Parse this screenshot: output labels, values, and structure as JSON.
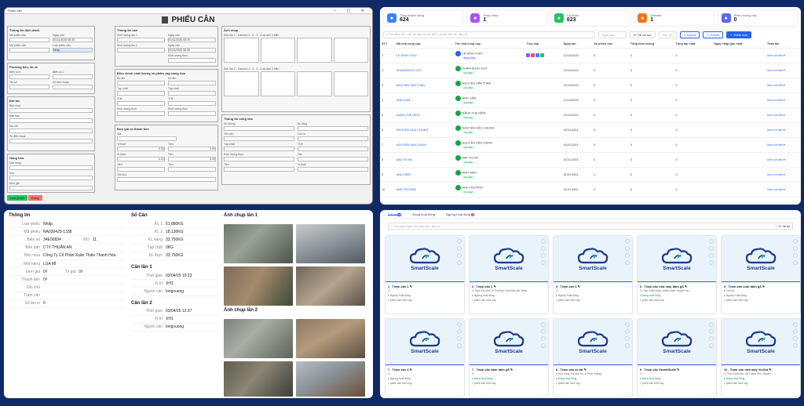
{
  "form": {
    "window_title": "Phiếu cân",
    "title": "PHIẾU CÂN",
    "sec_info": "Thông tin định danh",
    "sec_route": "Phương tiện, lái xe",
    "sec_partner": "Đối tác",
    "sec_goods": "Hàng hóa",
    "sec_scale": "Thông tin cân",
    "sec_quality": "Điều chỉnh chất lượng và phẩm cấp hàng hóa",
    "sec_price": "Đơn giá và thành tiền",
    "sec_img1": "Ảnh chụp",
    "img1_caption": "Ảnh lần 1 - Camera 1 - 2 - 3 - 4 và ảnh 2 biển",
    "img2_caption": "Ảnh lần 2 - Camera 1 - 2 - 3 - 4 và ảnh 2 biển",
    "sec_inout": "Thông tin cổng vào",
    "btn_save": "Lưu (F10)",
    "btn_close": "Đóng",
    "f_phieu": "Mã phiếu cân",
    "f_ngay": "Ngày cân",
    "f_loai": "Loại phiếu cân",
    "loai_val": "Nhập",
    "f_bien": "Biển số 1",
    "f_bien2": "Biển số 2",
    "f_taixe": "Tài xế",
    "f_sdt": "Số điện thoại",
    "f_ben": "Bên mua",
    "f_benban": "Bên bán",
    "f_diachi": "Địa chỉ",
    "f_hang": "Mặt hàng",
    "f_kho": "Kho",
    "f_dongia": "Đơn giá",
    "f_chuan": "Tỉ trọng chuẩn",
    "f_kl1": "Khối lượng lần 1",
    "f_kl2": "Khối lượng lần 2",
    "f_tap": "Tạp chất",
    "f_kho2": "Độ ẩm",
    "f_tl": "Tỉ lệ",
    "f_thuc": "Khối lượng thực",
    "f_gia": "Giá",
    "f_tien": "Tiền",
    "f_thue": "% thuế",
    "f_ghichu": "Ghi chú",
    "f_sl": "Số lượng",
    "f_kl": "KL tổng",
    "f_vao": "Giờ vào",
    "f_ra": "Giờ ra",
    "date1": "01/11/2025 08:30",
    "date2": "01/11/2025 08:30",
    "num0": "0.00"
  },
  "list": {
    "stats": [
      {
        "label": "Tổng khách hàng",
        "value": "624",
        "color": "#3b82f6",
        "icon": "users-icon"
      },
      {
        "label": "Pháp nhân",
        "value": "1",
        "color": "#a855f7",
        "icon": "building-icon"
      },
      {
        "label": "Cá nhân",
        "value": "623",
        "color": "#22c55e",
        "icon": "person-icon"
      },
      {
        "label": "Website",
        "value": "1",
        "color": "#f97316",
        "icon": "globe-icon"
      },
      {
        "label": "Phiếu tháng này",
        "value": "0",
        "color": "#6366f1",
        "icon": "document-icon"
      }
    ],
    "search_placeholder": "Tìm theo tên, mã, số điện thoại, MST, email, liên hệ, địa chỉ...",
    "filter_placeholder": "Ngày tạo",
    "btn_all": "Tất cả lưu",
    "btn_delete": "Xóa (0)",
    "btn_import": "Import",
    "btn_export": "Export",
    "btn_add": "+ Thêm mới",
    "columns": [
      "STT",
      "Mã nhà cung cấp",
      "Tên nhà cung cấp",
      "Truy cập",
      "Ngày tạo",
      "Số phiếu cân",
      "Tổng khối lượng",
      "Tổng tạp chất",
      "Ngày nhập gần nhất",
      "Thao tác"
    ],
    "rows": [
      {
        "stt": "1",
        "code": "LE DINH THUY",
        "name": "LÊ ĐÌNH THUỶ",
        "badge": "Pháp nhân",
        "date": "12/10/2025",
        "count": "0",
        "w": "0",
        "t": "0",
        "last": "",
        "action": "Xem chi tiết"
      },
      {
        "stt": "2",
        "code": "PHAM NGOC DUY",
        "name": "PHẠM NGỌC DUY",
        "badge": "Cá nhân",
        "date": "12/10/2025",
        "count": "0",
        "w": "0",
        "t": "0",
        "last": "",
        "action": "Xem chi tiết"
      },
      {
        "stt": "3",
        "code": "NGUYEN VAN TOAN",
        "name": "NGUYỄN VĂN TOÀN",
        "badge": "Cá nhân",
        "date": "12/10/2025",
        "count": "0",
        "w": "0",
        "t": "0",
        "last": "",
        "action": "Xem chi tiết"
      },
      {
        "stt": "4",
        "code": "ANH CAM",
        "name": "ANH CẦM",
        "badge": "Cá nhân",
        "date": "12/10/2025",
        "count": "0",
        "w": "0",
        "t": "0",
        "last": "",
        "action": "Xem chi tiết"
      },
      {
        "stt": "5",
        "code": "DANG THE DIEN",
        "name": "ĐẶNG THẾ DIỆN",
        "badge": "Cá nhân",
        "date": "12/10/2025",
        "count": "0",
        "w": "0",
        "t": "0",
        "last": "",
        "action": "Xem chi tiết"
      },
      {
        "stt": "6",
        "code": "NGUYEN HUU CHUNG",
        "name": "NGUYỄN HỮU CHUNG",
        "badge": "Cá nhân",
        "date": "01/01/1901",
        "count": "0",
        "w": "0",
        "t": "0",
        "last": "",
        "action": "Xem chi tiết"
      },
      {
        "stt": "7",
        "code": "NGUYEN VAN CHINH",
        "name": "NGUYỄN VĂN CHÍNH",
        "badge": "Cá nhân",
        "date": "01/01/1901",
        "count": "0",
        "w": "0",
        "t": "0",
        "last": "",
        "action": "Xem chi tiết"
      },
      {
        "stt": "8",
        "code": "MAI THI HA",
        "name": "MAI THỊ HÀ",
        "badge": "Cá nhân",
        "date": "01/01/1901",
        "count": "0",
        "w": "0",
        "t": "0",
        "last": "",
        "action": "Xem chi tiết"
      },
      {
        "stt": "9",
        "code": "ANH HIEN",
        "name": "ANH HIỀN",
        "badge": "Cá nhân",
        "date": "01/01/1901",
        "count": "0",
        "w": "0",
        "t": "0",
        "last": "",
        "action": "Xem chi tiết"
      },
      {
        "stt": "10",
        "code": "ANH TRUONG",
        "name": "ANH TRƯỜNG",
        "badge": "Cá nhân",
        "date": "01/01/1901",
        "count": "0",
        "w": "0",
        "t": "0",
        "last": "",
        "action": "Xem chi tiết"
      }
    ]
  },
  "detail": {
    "info_title": "Thông tin",
    "info": [
      {
        "k": "Loại phiếu",
        "v": "Nhập"
      },
      {
        "k": "Mã phiếu",
        "v": "NA030425-1338"
      },
      {
        "k": "Biển số",
        "v": "34E00834",
        "k2": "ĐO",
        "v2": "11"
      },
      {
        "k": "Bên bán",
        "v": "CTY THUẬN AN"
      },
      {
        "k": "Bên mua",
        "v": "Công Ty Cổ Phần Xuân Thiện Thanh Hóa"
      },
      {
        "k": "Mặt hàng",
        "v": "LÚA MÌ"
      },
      {
        "k": "Đơn giá",
        "v": "0₫",
        "k2": "Trị giá",
        "v2": "0₫"
      },
      {
        "k": "Thành tiền",
        "v": "0₫"
      },
      {
        "k": "Ghi chú",
        "v": ""
      },
      {
        "k": "Trạm cân",
        "v": ""
      },
      {
        "k": "Số lần in",
        "v": "0"
      }
    ],
    "scale_title": "Số Cân",
    "scale": [
      {
        "k": "KL 1",
        "v": "51,880KG"
      },
      {
        "k": "KL 2",
        "v": "18,130KG"
      },
      {
        "k": "KL hàng",
        "v": "33,750KG"
      },
      {
        "k": "Tạp chất",
        "v": "0KG"
      },
      {
        "k": "KL thực",
        "v": "33,750KG"
      }
    ],
    "w1_title": "Cân lần 1",
    "w1": [
      {
        "k": "Thời gian",
        "v": "03/04/25 10:23"
      },
      {
        "k": "Vị trí",
        "v": "XH1"
      },
      {
        "k": "Người cân",
        "v": "longvuong"
      }
    ],
    "w2_title": "Cân lần 2",
    "w2": [
      {
        "k": "Thời gian",
        "v": "03/04/25 12:37"
      },
      {
        "k": "Vị trí",
        "v": "XH1"
      },
      {
        "k": "Người cân",
        "v": "longvuong"
      }
    ],
    "photo1_title": "Ảnh chụp lần 1",
    "photo2_title": "Ảnh chụp lần 2"
  },
  "stations": {
    "tabs": [
      {
        "label": "Tất cả",
        "count": "10"
      },
      {
        "label": "Đang hoạt động",
        "count": ""
      },
      {
        "label": "Ngừng hoạt động",
        "count": "3"
      }
    ],
    "search_placeholder": "Tìm kiếm trạm cân theo tên, địa chỉ",
    "refresh": "Tải lại",
    "brand": "SmartScale",
    "cards": [
      {
        "title": "1 . Trạm cân 1",
        "addr": "",
        "status": "Ngừng hoạt động",
        "today": "1 phiếu cân hôm nay"
      },
      {
        "title": "2 . Trạm cân 2",
        "addr": "Trạm Khu Mỏ Tế Trường, Cam Kiên Bá, Hiệp...",
        "status": "Ngừng hoạt động",
        "today": "1 phiếu cân hôm nay"
      },
      {
        "title": "3 . Trạm cân 3",
        "addr": "",
        "status": "Ngừng hoạt động",
        "today": "1 phiếu cân hôm nay"
      },
      {
        "title": "6 . Trạm cân nhà máy đậm gỗ",
        "addr": "Cụm Chiến Đấu, Khổa Hoàn, Huyện Ha...",
        "status": "Đang hoạt động",
        "today": "1 phiếu cân hôm nay"
      },
      {
        "title": "5 . Trạm cân cuối dăm gỗ",
        "addr": "Hà Nội",
        "status": "Ngừng hoạt động",
        "today": "1 phiếu cân hôm nay"
      },
      {
        "title": "7 . Trạm cân 4",
        "addr": "",
        "status": "Ngừng hoạt động",
        "today": "1 phiếu cân hôm nay"
      },
      {
        "title": "7 . Trạm cân băm dăm gỗ",
        "addr": "",
        "status": "Đang hoạt động",
        "today": "1 phiếu cân hôm nay"
      },
      {
        "title": "8 . Trạm cân xe tải",
        "addr": "Khu công, Hà Nội Xin, Á Phúc Thắng...",
        "status": "Đang hoạt động",
        "today": "1 phiếu cân hôm nay"
      },
      {
        "title": "9 . Trạm cân SmartScale",
        "addr": "",
        "status": "Đang hoạt động",
        "today": "1 phiếu cân hôm nay"
      },
      {
        "title": "10 . Trạm cân nhà máy VinSat",
        "addr": "Thôn Khổi Kẹo, Xã Thành Phú, Huyện...",
        "status": "Đang hoạt động",
        "today": "1 phiếu cân hôm nay"
      }
    ]
  }
}
